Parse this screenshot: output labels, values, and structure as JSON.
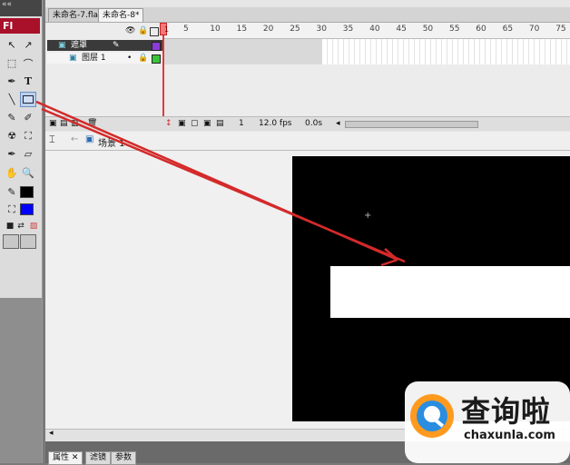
{
  "toolbox": {
    "collapse_glyph": "««",
    "logo": "Fl",
    "tools": [
      "selection-tool",
      "subselection-tool",
      "free-transform-tool",
      "lasso-tool",
      "pen-tool",
      "text-tool",
      "line-tool",
      "rectangle-tool",
      "pencil-tool",
      "brush-tool",
      "ink-bottle-tool",
      "paint-bucket-tool",
      "eyedropper-tool",
      "eraser-tool",
      "hand-tool",
      "zoom-tool"
    ],
    "text_tool_label": "T"
  },
  "tabs": [
    {
      "label": "未命名-7.fla"
    },
    {
      "label": "未命名-8*"
    }
  ],
  "timeline": {
    "ruler_ticks": [
      "5",
      "10",
      "15",
      "20",
      "25",
      "30",
      "35",
      "40",
      "45",
      "50",
      "55",
      "60",
      "65",
      "70",
      "75"
    ],
    "ruler_first": "1",
    "layers": [
      {
        "name": "遮罩",
        "type": "mask"
      },
      {
        "name": "图层 1",
        "type": "masked"
      }
    ],
    "status": {
      "frame": "1",
      "fps": "12.0 fps",
      "time": "0.0s"
    }
  },
  "scene": {
    "name": "场景 1"
  },
  "panels": {
    "tabs": [
      "属性",
      "滤镜",
      "参数"
    ]
  },
  "colors": {
    "stroke": "#000000",
    "fill": "#0000ff",
    "layer_purple": "#8a3dd6",
    "layer_green": "#3ac43a",
    "arrow": "#d42a2a"
  },
  "watermark": {
    "title": "查询啦",
    "url": "chaxunla.com"
  }
}
